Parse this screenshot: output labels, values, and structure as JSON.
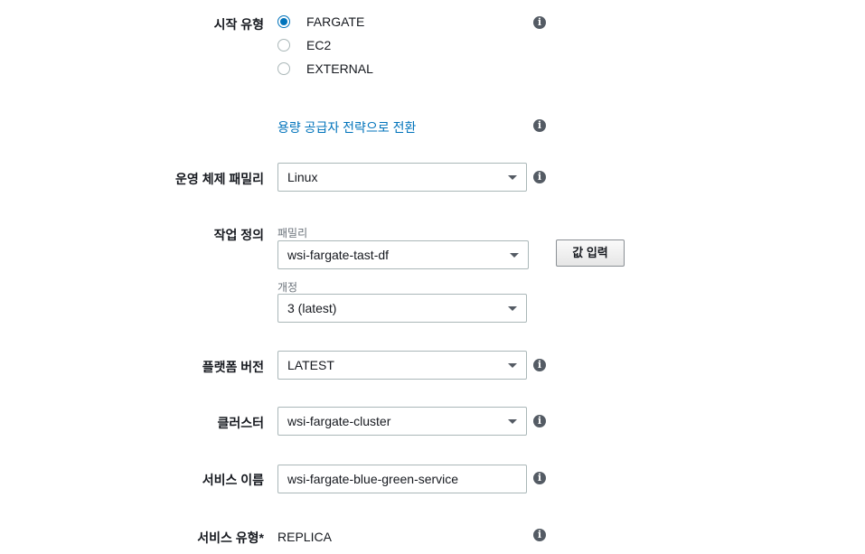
{
  "launch_type": {
    "label": "시작 유형",
    "options": [
      {
        "label": "FARGATE",
        "selected": true
      },
      {
        "label": "EC2",
        "selected": false
      },
      {
        "label": "EXTERNAL",
        "selected": false
      }
    ]
  },
  "capacity_link": "용량 공급자 전략으로 전환",
  "os_family": {
    "label": "운영 체제 패밀리",
    "value": "Linux"
  },
  "task_definition": {
    "label": "작업 정의",
    "family_label": "패밀리",
    "family_value": "wsi-fargate-tast-df",
    "enter_value_button": "값 입력",
    "revision_label": "개정",
    "revision_value": "3 (latest)"
  },
  "platform_version": {
    "label": "플랫폼 버전",
    "value": "LATEST"
  },
  "cluster": {
    "label": "클러스터",
    "value": "wsi-fargate-cluster"
  },
  "service_name": {
    "label": "서비스 이름",
    "value": "wsi-fargate-blue-green-service"
  },
  "service_type": {
    "label": "서비스 유형*",
    "value": "REPLICA"
  },
  "icons": {
    "info": "i",
    "accent": "#0073bb"
  }
}
